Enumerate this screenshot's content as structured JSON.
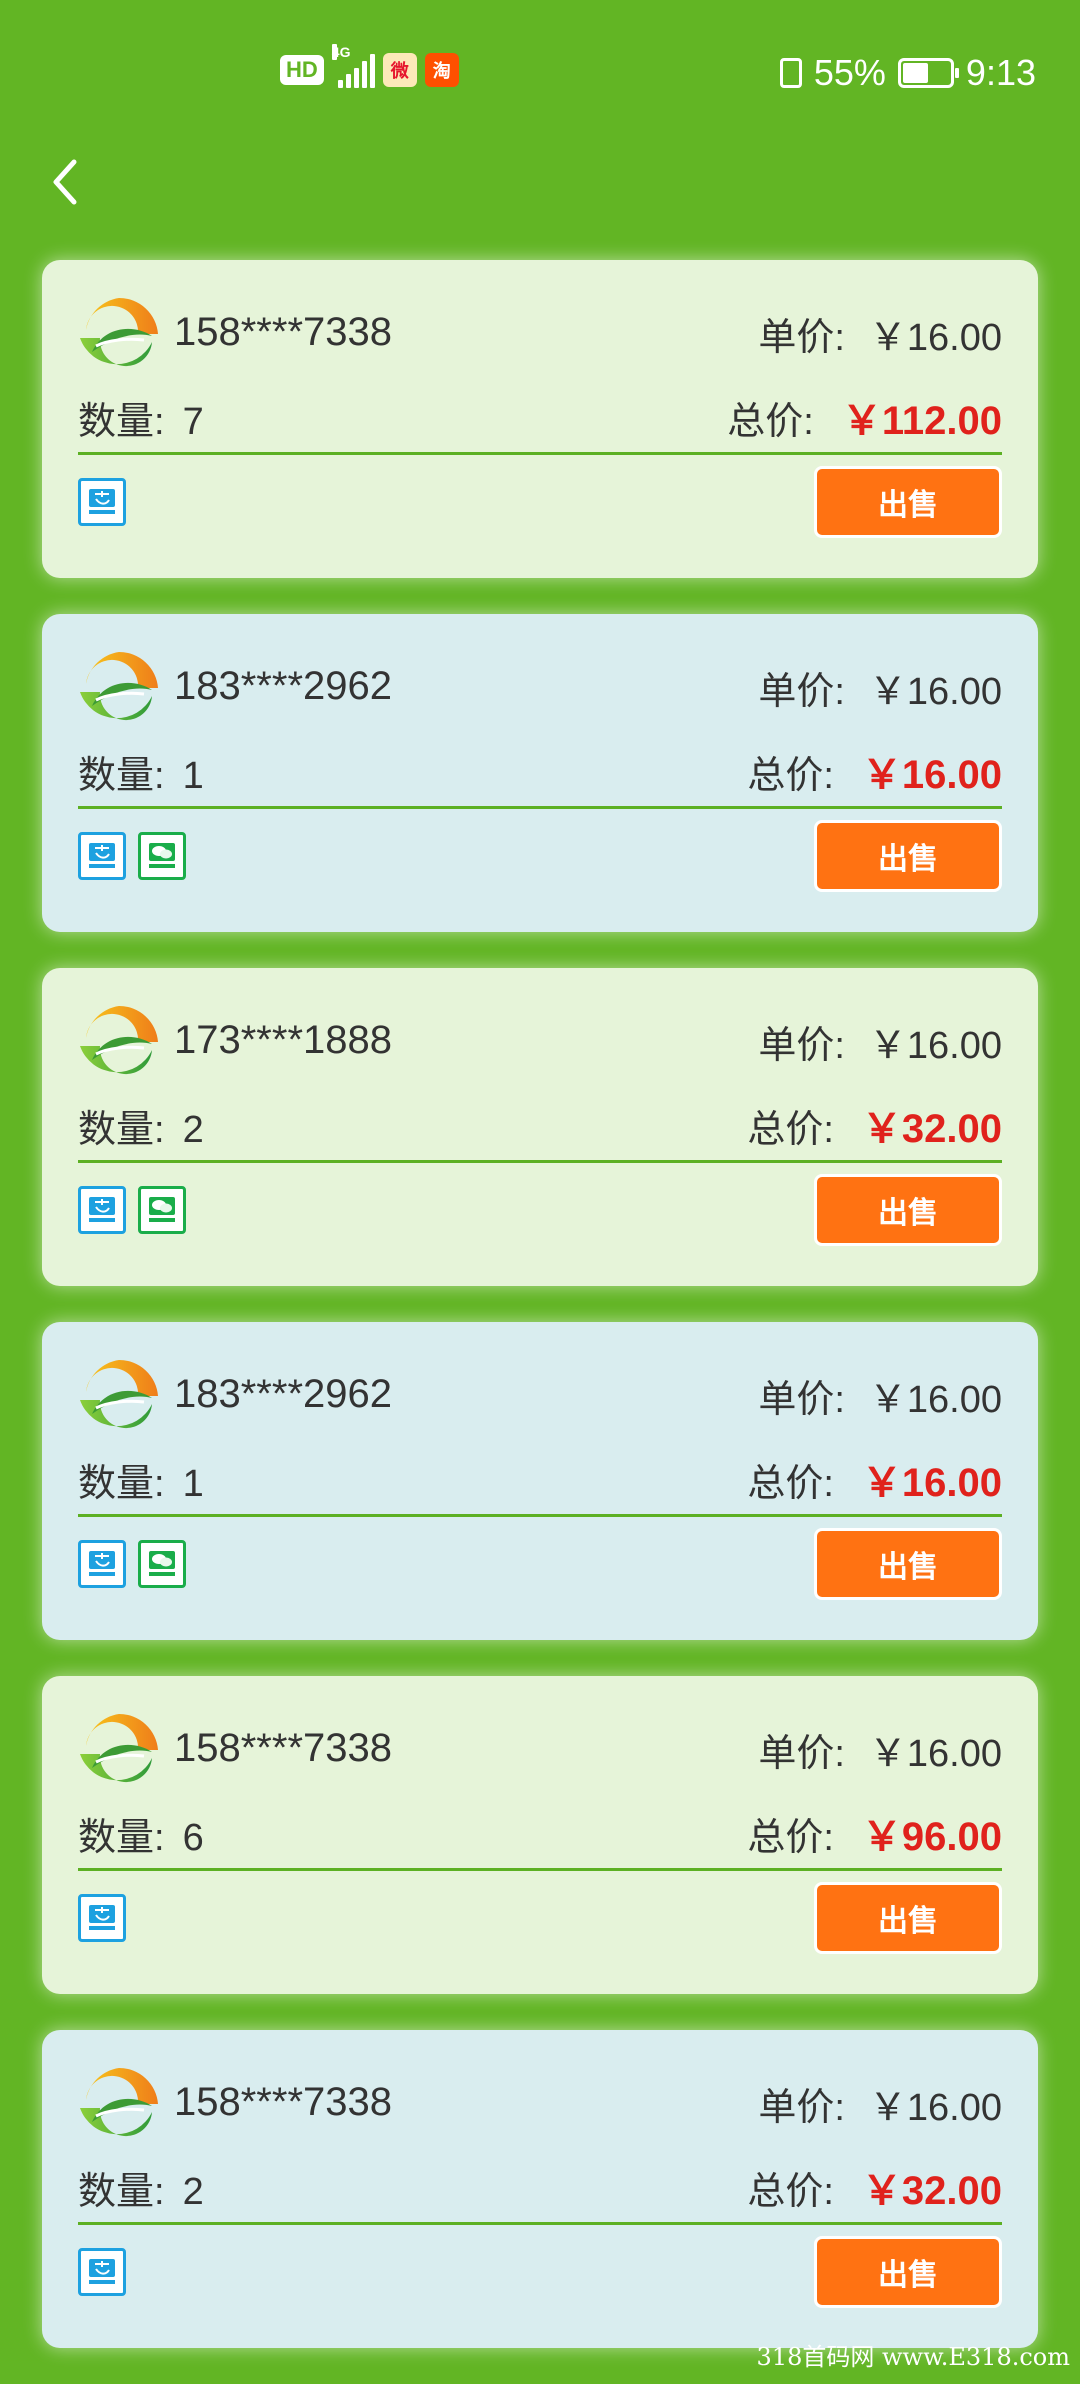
{
  "status_bar": {
    "hd_label": "HD",
    "network_label": "4G",
    "weibo_label": "微",
    "taobao_label": "淘",
    "battery_percent": "55%",
    "battery_level": 0.55,
    "time": "9:13"
  },
  "icons": {
    "back": "chevron-left-icon",
    "alipay": "alipay-icon",
    "wechat": "wechat-pay-icon"
  },
  "colors": {
    "background": "#62b524",
    "card_green": "#e6f4d9",
    "card_blue": "#d9edef",
    "sell_button": "#ff7212",
    "total_price": "#e0221c",
    "divider": "#5cb023"
  },
  "labels": {
    "unit_price": "单价:",
    "quantity": "数量:",
    "total": "总价:",
    "sell": "出售"
  },
  "orders": [
    {
      "phone": "158****7338",
      "unit_price": "￥16.00",
      "quantity": "7",
      "total": "￥112.00",
      "payments": [
        "alipay"
      ],
      "theme": "green"
    },
    {
      "phone": "183****2962",
      "unit_price": "￥16.00",
      "quantity": "1",
      "total": "￥16.00",
      "payments": [
        "alipay",
        "wechat"
      ],
      "theme": "blue"
    },
    {
      "phone": "173****1888",
      "unit_price": "￥16.00",
      "quantity": "2",
      "total": "￥32.00",
      "payments": [
        "alipay",
        "wechat"
      ],
      "theme": "green"
    },
    {
      "phone": "183****2962",
      "unit_price": "￥16.00",
      "quantity": "1",
      "total": "￥16.00",
      "payments": [
        "alipay",
        "wechat"
      ],
      "theme": "blue"
    },
    {
      "phone": "158****7338",
      "unit_price": "￥16.00",
      "quantity": "6",
      "total": "￥96.00",
      "payments": [
        "alipay"
      ],
      "theme": "green"
    },
    {
      "phone": "158****7338",
      "unit_price": "￥16.00",
      "quantity": "2",
      "total": "￥32.00",
      "payments": [
        "alipay"
      ],
      "theme": "blue"
    }
  ],
  "watermark": "318首码网 www.E318.com"
}
